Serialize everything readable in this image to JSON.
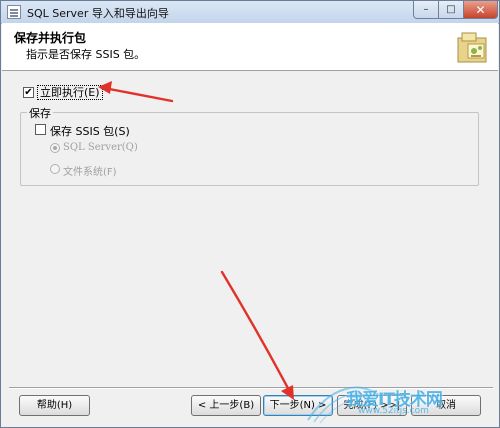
{
  "window": {
    "title": "SQL Server 导入和导出向导",
    "controls": {
      "minimize": "–",
      "maximize": "□",
      "close": "✕"
    }
  },
  "header": {
    "title": "保存并执行包",
    "subtitle": "指示是否保存 SSIS 包。",
    "icon": "wizard-folder-icon"
  },
  "options": {
    "execute_immediately": {
      "label": "立即执行(E)",
      "checked": true
    },
    "save_group": {
      "title": "保存",
      "save_ssis": {
        "label": "保存 SSIS 包(S)",
        "checked": false
      },
      "destinations": [
        {
          "label": "SQL Server(Q)",
          "selected": true,
          "enabled": false
        },
        {
          "label": "文件系统(F)",
          "selected": false,
          "enabled": false
        }
      ]
    }
  },
  "buttons": {
    "help": "帮助(H)",
    "back": "< 上一步(B)",
    "next": "下一步(N) >",
    "finish": "完成(F) >>|",
    "cancel": "取消"
  },
  "watermark": {
    "text": "我爱IT技术网",
    "url": "www.52itjs.com"
  },
  "colors": {
    "annotation_arrow": "#e0322a",
    "watermark": "#49b2e8"
  }
}
